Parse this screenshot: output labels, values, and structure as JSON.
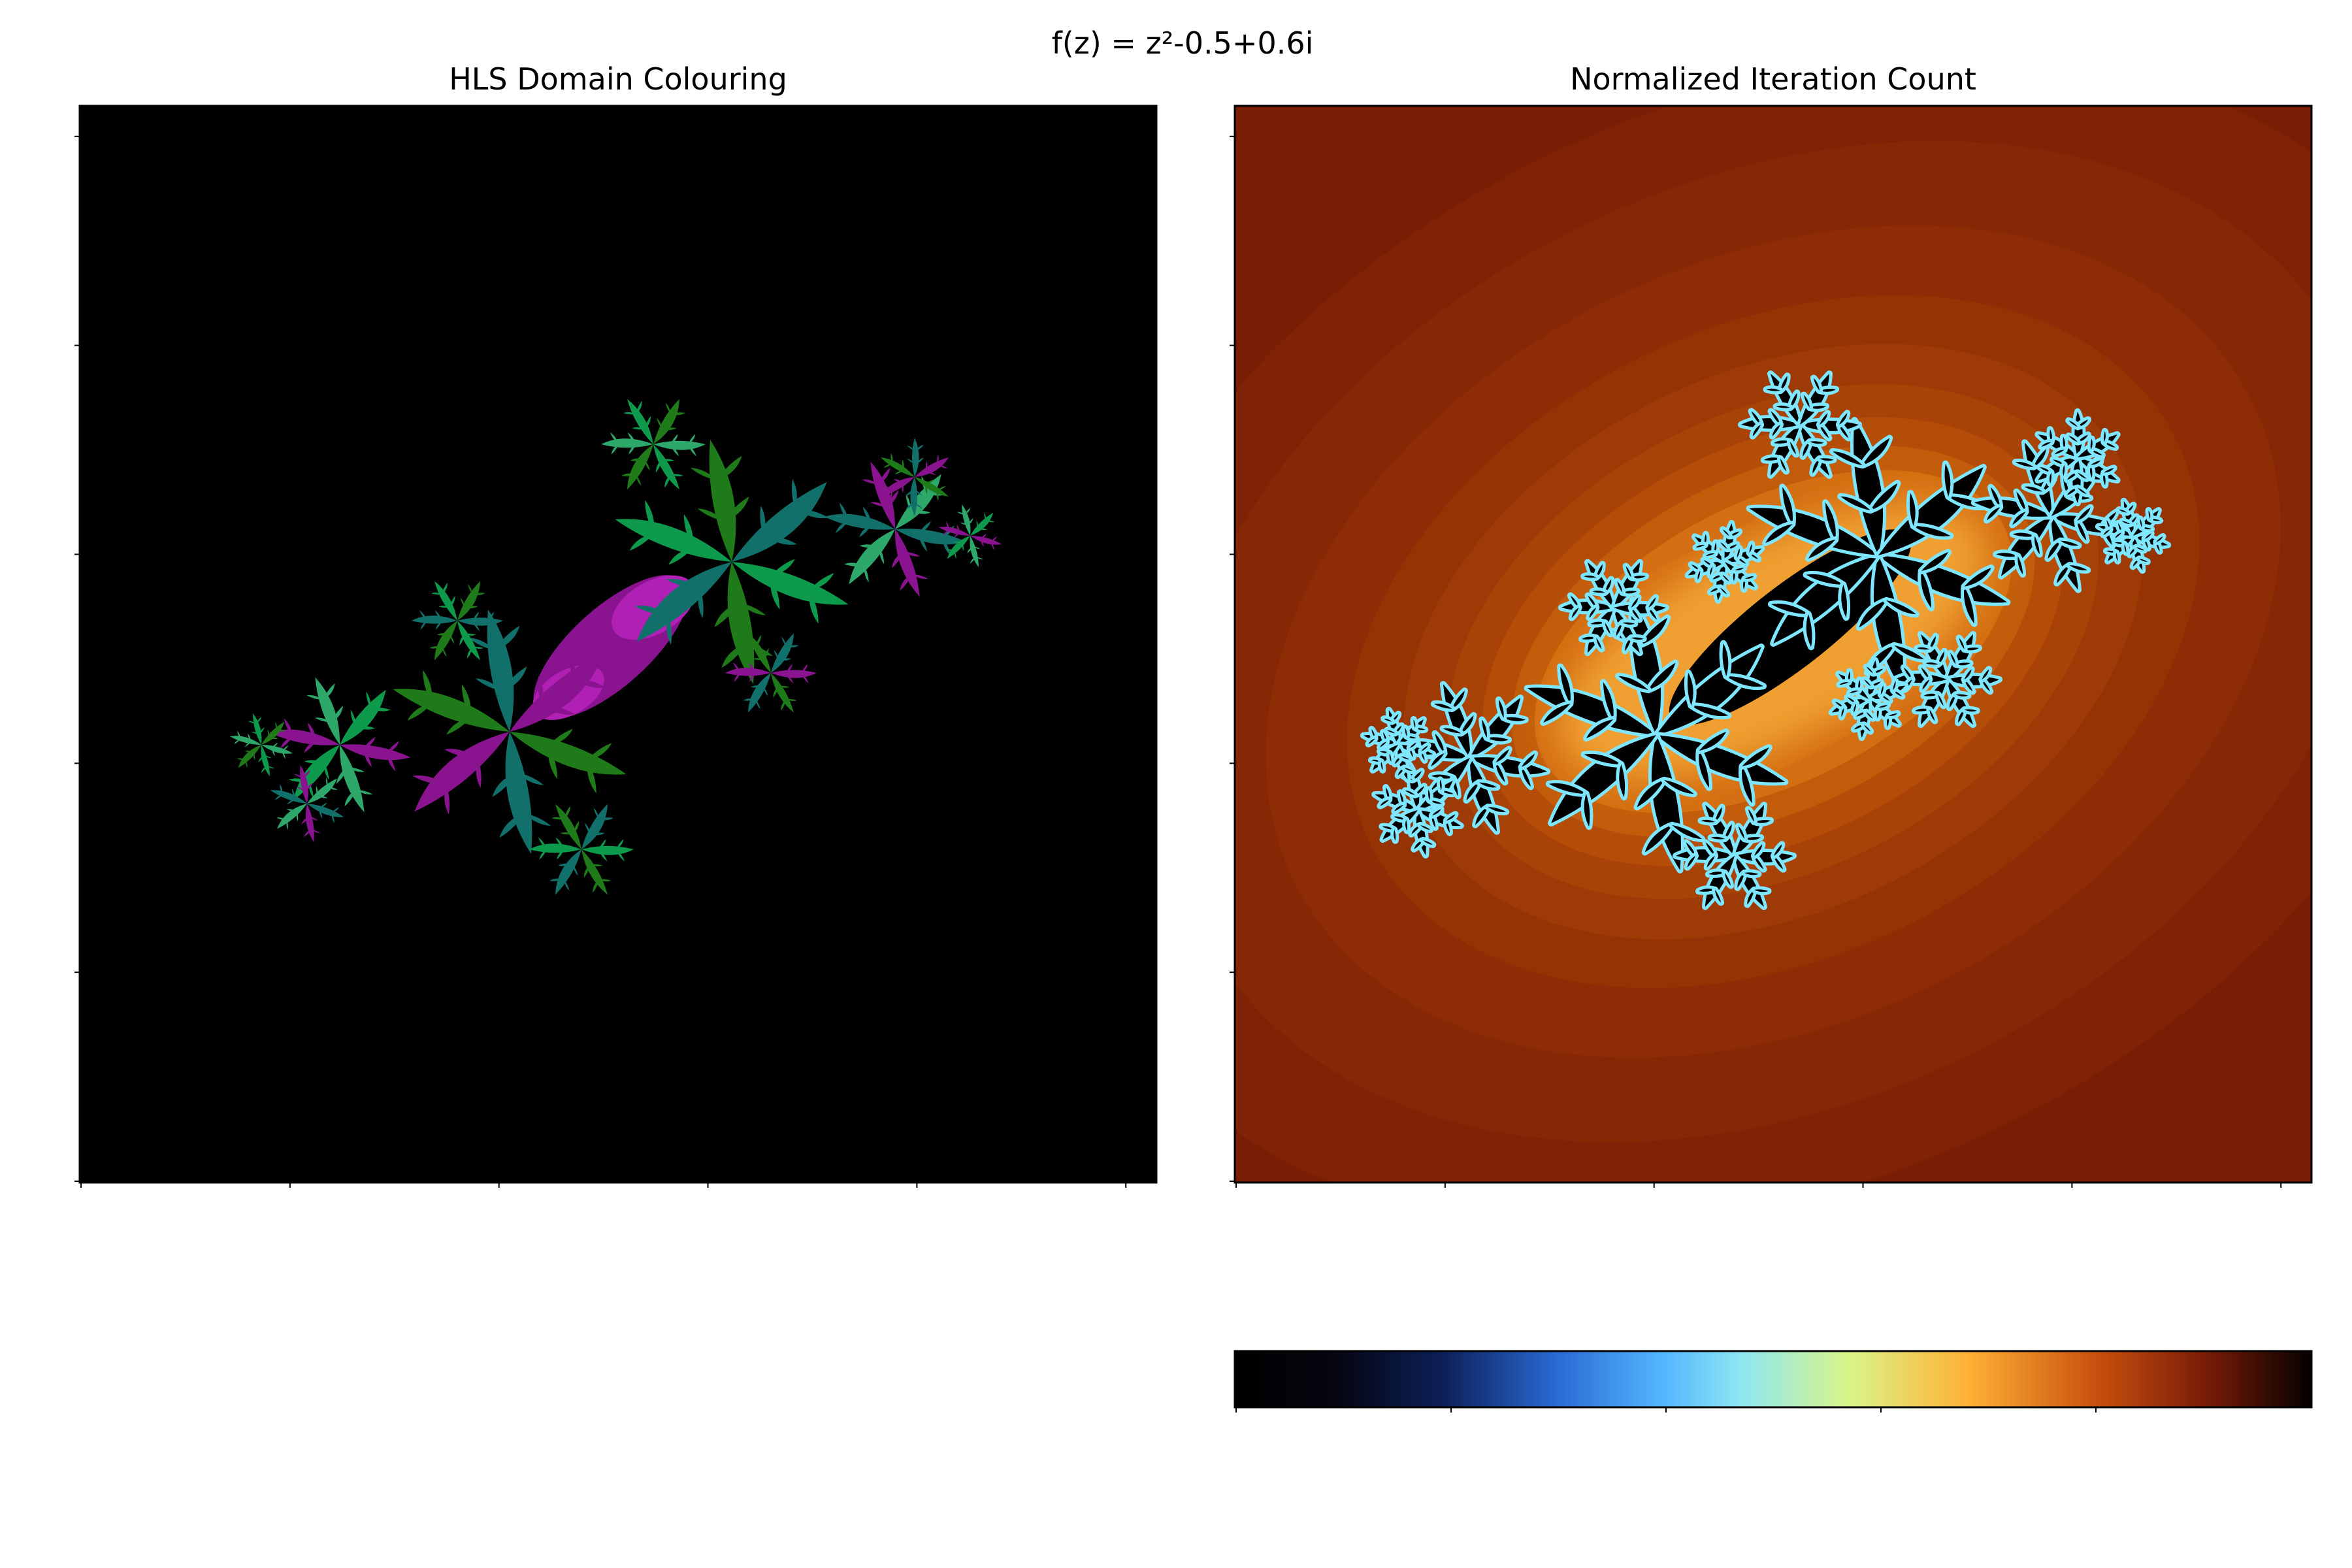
{
  "figure": {
    "suptitle": "f(z) = z²-0.5+0.6i"
  },
  "chart_data": [
    {
      "type": "heatmap",
      "title": "HLS Domain Colouring",
      "xlabel": "",
      "ylabel": "",
      "function": "f(z) = z²-0.5+0.6i",
      "c": {
        "re": -0.5,
        "im": 0.6
      },
      "ticks_visible": false,
      "grid": false,
      "background_color": "#000000",
      "hue_palette": [
        "#0d9a4c",
        "#1f7a1a",
        "#12706b",
        "#8a138f",
        "#2ea86a"
      ]
    },
    {
      "type": "heatmap",
      "title": "Normalized Iteration Count",
      "xlabel": "",
      "ylabel": "",
      "function": "f(z) = z²-0.5+0.6i",
      "c": {
        "re": -0.5,
        "im": 0.6
      },
      "ticks_visible": false,
      "grid": false,
      "interior_color": "#000000",
      "colorbar": {
        "orientation": "horizontal",
        "placement": "bottom",
        "ticks_visible": false,
        "colormap_stops": [
          {
            "offset": 0.0,
            "color": "#000000"
          },
          {
            "offset": 0.09,
            "color": "#05050f"
          },
          {
            "offset": 0.19,
            "color": "#0b1e55"
          },
          {
            "offset": 0.3,
            "color": "#2a6bd4"
          },
          {
            "offset": 0.4,
            "color": "#55b8ff"
          },
          {
            "offset": 0.47,
            "color": "#8ee6f2"
          },
          {
            "offset": 0.57,
            "color": "#d8f58a"
          },
          {
            "offset": 0.68,
            "color": "#ffb236"
          },
          {
            "offset": 0.8,
            "color": "#c9510e"
          },
          {
            "offset": 0.9,
            "color": "#7a1d05"
          },
          {
            "offset": 1.0,
            "color": "#050000"
          }
        ]
      }
    }
  ]
}
